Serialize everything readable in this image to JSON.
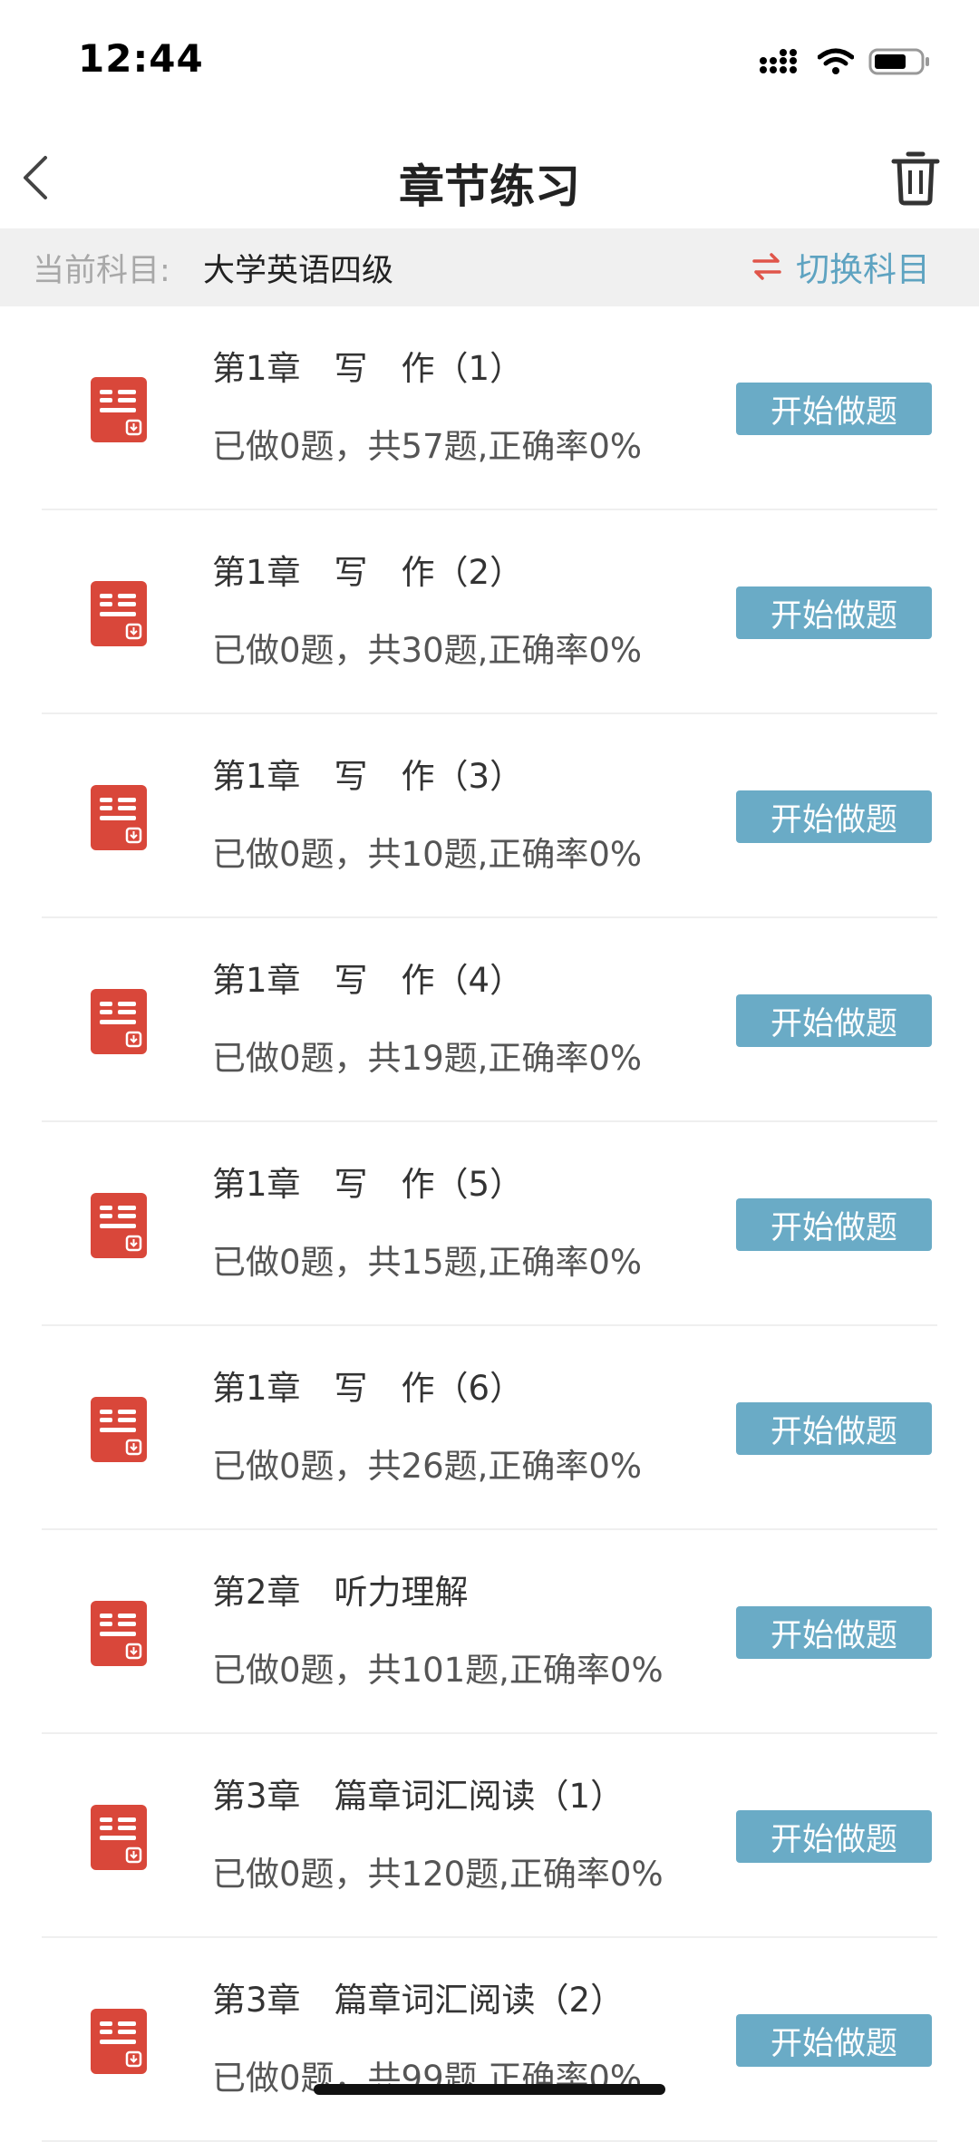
{
  "status_bar": {
    "time": "12:44",
    "icons": [
      "signal-icon",
      "wifi-icon",
      "battery-icon"
    ]
  },
  "nav": {
    "title": "章节练习",
    "back_icon": "chevron-left-icon",
    "trash_icon": "trash-icon"
  },
  "subject": {
    "label": "当前科目:",
    "value": "大学英语四级",
    "switch_label": "切换科目",
    "switch_icon": "swap-arrows-icon"
  },
  "chapters": [
    {
      "title": "第1章　写　作（1）",
      "stats": "已做0题，共57题,正确率0%",
      "button": "开始做题"
    },
    {
      "title": "第1章　写　作（2）",
      "stats": "已做0题，共30题,正确率0%",
      "button": "开始做题"
    },
    {
      "title": "第1章　写　作（3）",
      "stats": "已做0题，共10题,正确率0%",
      "button": "开始做题"
    },
    {
      "title": "第1章　写　作（4）",
      "stats": "已做0题，共19题,正确率0%",
      "button": "开始做题"
    },
    {
      "title": "第1章　写　作（5）",
      "stats": "已做0题，共15题,正确率0%",
      "button": "开始做题"
    },
    {
      "title": "第1章　写　作（6）",
      "stats": "已做0题，共26题,正确率0%",
      "button": "开始做题"
    },
    {
      "title": "第2章　听力理解",
      "stats": "已做0题，共101题,正确率0%",
      "button": "开始做题"
    },
    {
      "title": "第3章　篇章词汇阅读（1）",
      "stats": "已做0题，共120题,正确率0%",
      "button": "开始做题"
    },
    {
      "title": "第3章　篇章词汇阅读（2）",
      "stats": "已做0题，共99题,正确率0%",
      "button": "开始做题"
    }
  ],
  "colors": {
    "accent": "#6aabc6",
    "icon_red": "#d9473a",
    "switch_arrow": "#e0554a"
  }
}
